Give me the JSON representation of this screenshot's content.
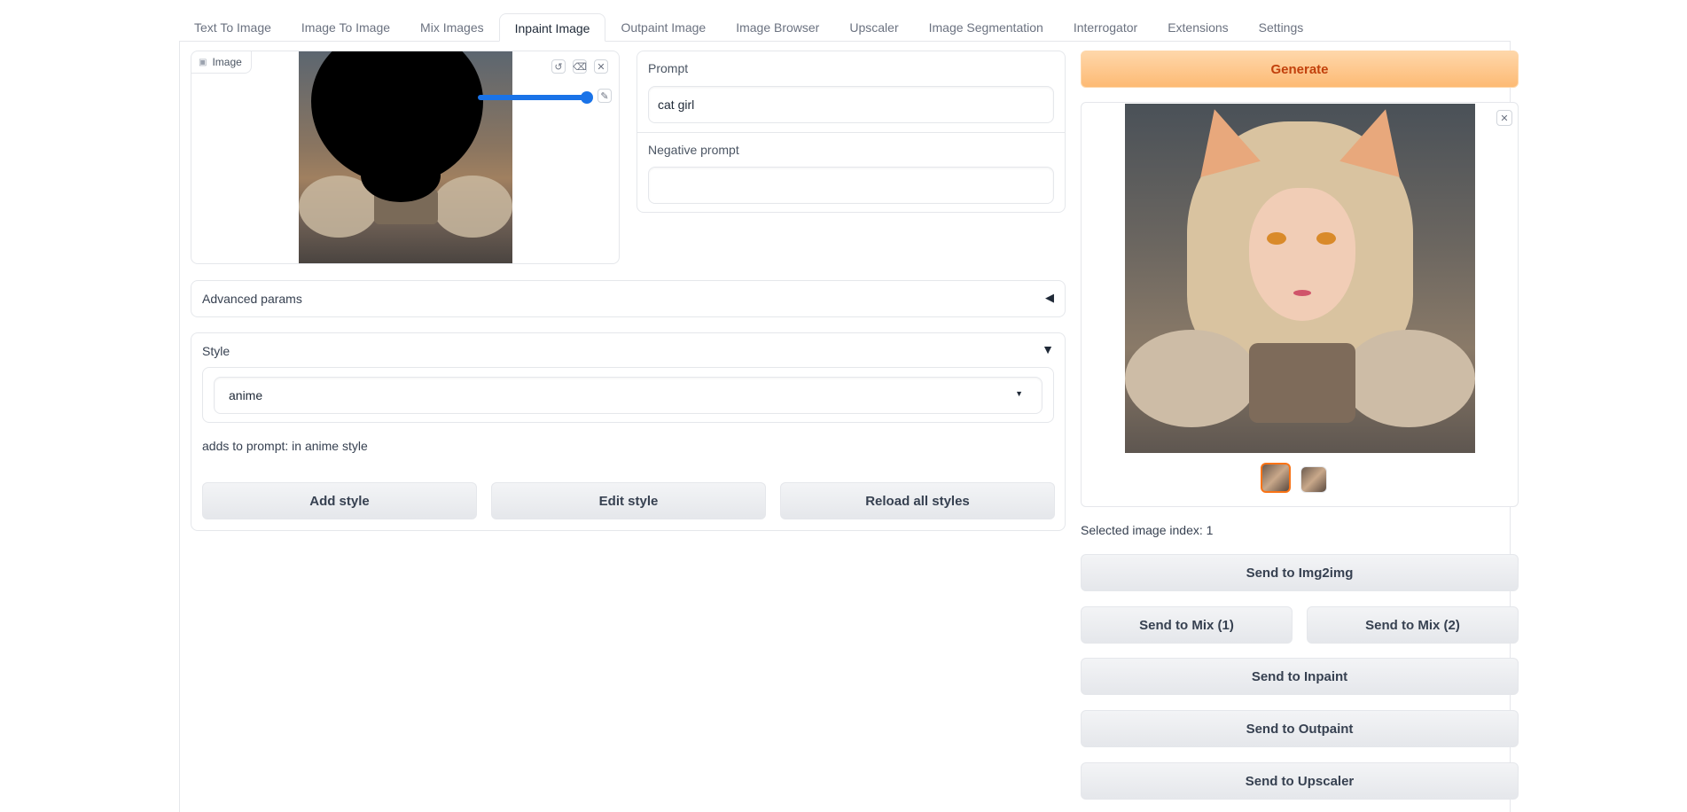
{
  "tabs": [
    "Text To Image",
    "Image To Image",
    "Mix Images",
    "Inpaint Image",
    "Outpaint Image",
    "Image Browser",
    "Upscaler",
    "Image Segmentation",
    "Interrogator",
    "Extensions",
    "Settings"
  ],
  "active_tab": "Inpaint Image",
  "image_panel": {
    "label": "Image",
    "brush_level": 1.0
  },
  "prompt": {
    "label": "Prompt",
    "value": "cat girl"
  },
  "negative_prompt": {
    "label": "Negative prompt",
    "value": ""
  },
  "advanced": {
    "label": "Advanced params",
    "arrow": "◀"
  },
  "style": {
    "label": "Style",
    "arrow": "▼",
    "selected": "anime",
    "description": "adds to prompt: in anime style",
    "add_label": "Add style",
    "edit_label": "Edit style",
    "reload_label": "Reload all styles"
  },
  "generate_label": "Generate",
  "selected_index_text": "Selected image index: 1",
  "send": {
    "img2img": "Send to Img2img",
    "mix1": "Send to Mix (1)",
    "mix2": "Send to Mix (2)",
    "inpaint": "Send to Inpaint",
    "outpaint": "Send to Outpaint",
    "upscaler": "Send to Upscaler"
  },
  "colors": {
    "accent_orange": "#f97316",
    "slider_blue": "#1a73e8"
  }
}
